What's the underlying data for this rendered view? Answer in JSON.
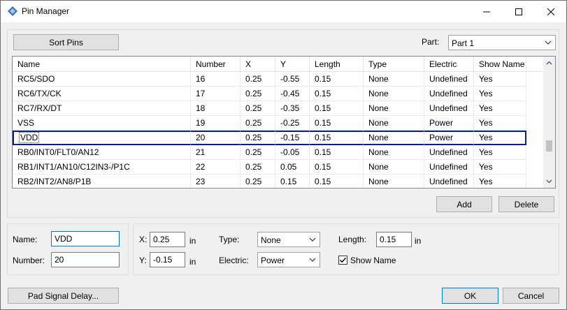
{
  "window": {
    "title": "Pin Manager"
  },
  "toolbar": {
    "sort_pins_label": "Sort Pins",
    "part_label": "Part:",
    "part_value": "Part 1"
  },
  "table": {
    "columns": [
      "Name",
      "Number",
      "X",
      "Y",
      "Length",
      "Type",
      "Electric",
      "Show Name"
    ],
    "rows": [
      [
        "RC5/SDO",
        "16",
        "0.25",
        "-0.55",
        "0.15",
        "None",
        "Undefined",
        "Yes"
      ],
      [
        "RC6/TX/CK",
        "17",
        "0.25",
        "-0.45",
        "0.15",
        "None",
        "Undefined",
        "Yes"
      ],
      [
        "RC7/RX/DT",
        "18",
        "0.25",
        "-0.35",
        "0.15",
        "None",
        "Undefined",
        "Yes"
      ],
      [
        "VSS",
        "19",
        "0.25",
        "-0.25",
        "0.15",
        "None",
        "Power",
        "Yes"
      ],
      [
        "VDD",
        "20",
        "0.25",
        "-0.15",
        "0.15",
        "None",
        "Power",
        "Yes"
      ],
      [
        "RB0/INT0/FLT0/AN12",
        "21",
        "0.25",
        "-0.05",
        "0.15",
        "None",
        "Undefined",
        "Yes"
      ],
      [
        "RB1/INT1/AN10/C12IN3-/P1C",
        "22",
        "0.25",
        "0.05",
        "0.15",
        "None",
        "Undefined",
        "Yes"
      ],
      [
        "RB2/INT2/AN8/P1B",
        "23",
        "0.25",
        "0.15",
        "0.15",
        "None",
        "Undefined",
        "Yes"
      ]
    ],
    "selected_row": 4
  },
  "actions": {
    "add_label": "Add",
    "delete_label": "Delete"
  },
  "editor": {
    "name_label": "Name:",
    "name_value": "VDD",
    "number_label": "Number:",
    "number_value": "20",
    "x_label": "X:",
    "x_value": "0.25",
    "x_unit": "in",
    "y_label": "Y:",
    "y_value": "-0.15",
    "y_unit": "in",
    "type_label": "Type:",
    "type_value": "None",
    "electric_label": "Electric:",
    "electric_value": "Power",
    "length_label": "Length:",
    "length_value": "0.15",
    "length_unit": "in",
    "show_name_label": "Show Name",
    "show_name_checked": true
  },
  "footer": {
    "pad_signal_delay_label": "Pad Signal Delay...",
    "ok_label": "OK",
    "cancel_label": "Cancel"
  },
  "colors": {
    "selection_border": "#0a1e8c",
    "focus_border": "#0078d7"
  }
}
